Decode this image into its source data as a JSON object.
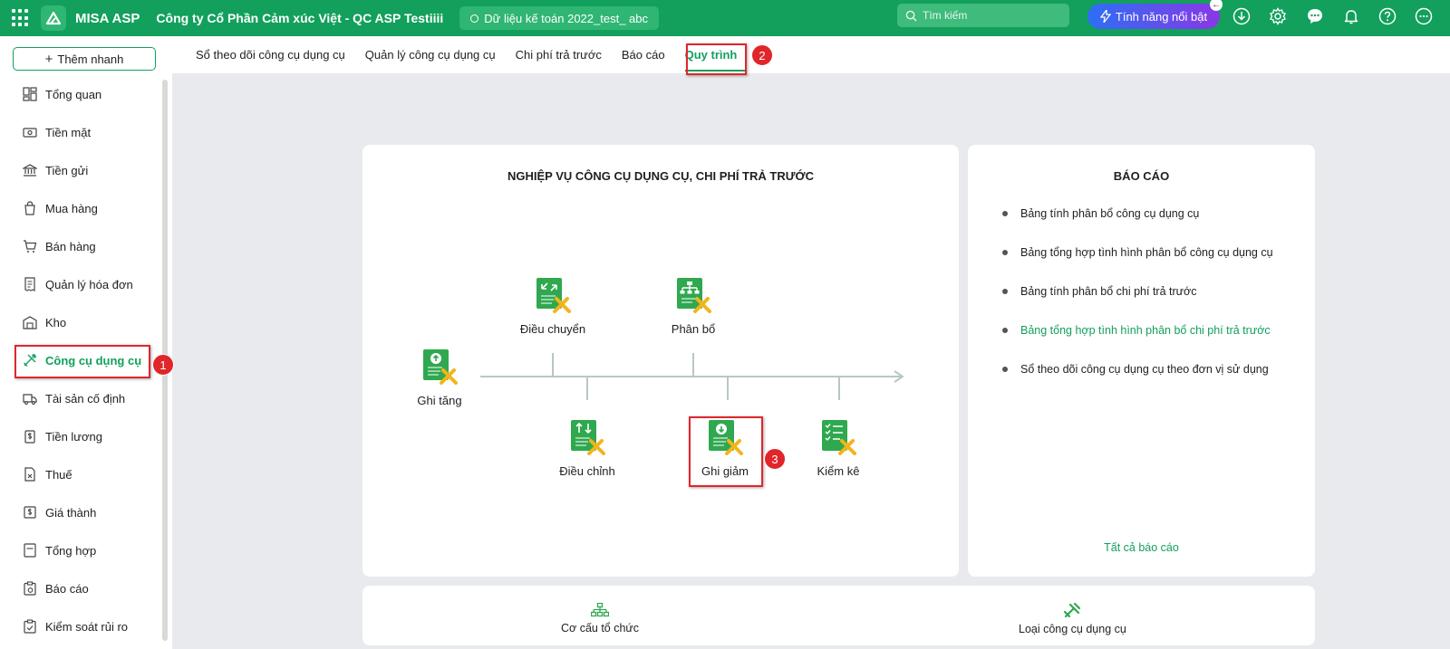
{
  "topbar": {
    "app_name": "MISA ASP",
    "company": "Công ty Cổ Phần Cảm xúc Việt - QC ASP Testiiii",
    "dataset": "Dữ liệu kế toán 2022_test_ abc",
    "search_placeholder": "Tìm kiếm",
    "feature_button": "Tính năng nổi bật",
    "bg_color": "#12a05c"
  },
  "sidebar": {
    "quick_add": "Thêm nhanh",
    "items": [
      {
        "label": "Tổng quan",
        "icon": "dashboard-icon"
      },
      {
        "label": "Tiền mặt",
        "icon": "cash-icon"
      },
      {
        "label": "Tiền gửi",
        "icon": "bank-icon"
      },
      {
        "label": "Mua hàng",
        "icon": "shopping-bag-icon"
      },
      {
        "label": "Bán hàng",
        "icon": "cart-icon"
      },
      {
        "label": "Quản lý hóa đơn",
        "icon": "invoice-icon"
      },
      {
        "label": "Kho",
        "icon": "warehouse-icon"
      },
      {
        "label": "Công cụ dụng cụ",
        "icon": "tools-icon"
      },
      {
        "label": "Tài sản cố định",
        "icon": "truck-icon"
      },
      {
        "label": "Tiền lương",
        "icon": "salary-icon"
      },
      {
        "label": "Thuế",
        "icon": "tax-icon"
      },
      {
        "label": "Giá thành",
        "icon": "price-icon"
      },
      {
        "label": "Tổng hợp",
        "icon": "summary-icon"
      },
      {
        "label": "Báo cáo",
        "icon": "report-icon"
      },
      {
        "label": "Kiểm soát rủi ro",
        "icon": "risk-icon"
      }
    ],
    "active_index": 7
  },
  "tabs": [
    {
      "label": "Sổ theo dõi công cụ dụng cụ"
    },
    {
      "label": "Quản lý công cụ dụng cụ"
    },
    {
      "label": "Chi phí trả trước"
    },
    {
      "label": "Báo cáo"
    },
    {
      "label": "Quy trình"
    }
  ],
  "active_tab": 4,
  "annotations": [
    "1",
    "2",
    "3"
  ],
  "process": {
    "title": "NGHIỆP VỤ CÔNG CỤ DỤNG CỤ, CHI PHÍ TRẢ TRƯỚC",
    "items": {
      "increase": "Ghi tăng",
      "transfer": "Điều chuyển",
      "allocate": "Phân bổ",
      "adjust": "Điều chỉnh",
      "decrease": "Ghi giảm",
      "inventory": "Kiểm kê"
    }
  },
  "reports": {
    "title": "BÁO CÁO",
    "items": [
      "Bảng tính phân bổ công cụ dụng cụ",
      "Bảng tổng hợp tình hình phân bổ công cụ dụng cụ",
      "Bảng tính phân bổ chi phí trả trước",
      "Bảng tổng hợp tình hình phân bổ chi phí trả trước",
      "Sổ theo dõi công cụ dụng cụ theo đơn vị sử dụng"
    ],
    "highlight_index": 3,
    "all_link": "Tất cả báo cáo"
  },
  "bottom": {
    "org": "Cơ cấu tổ chức",
    "tool_type": "Loại công cụ dụng cụ"
  }
}
